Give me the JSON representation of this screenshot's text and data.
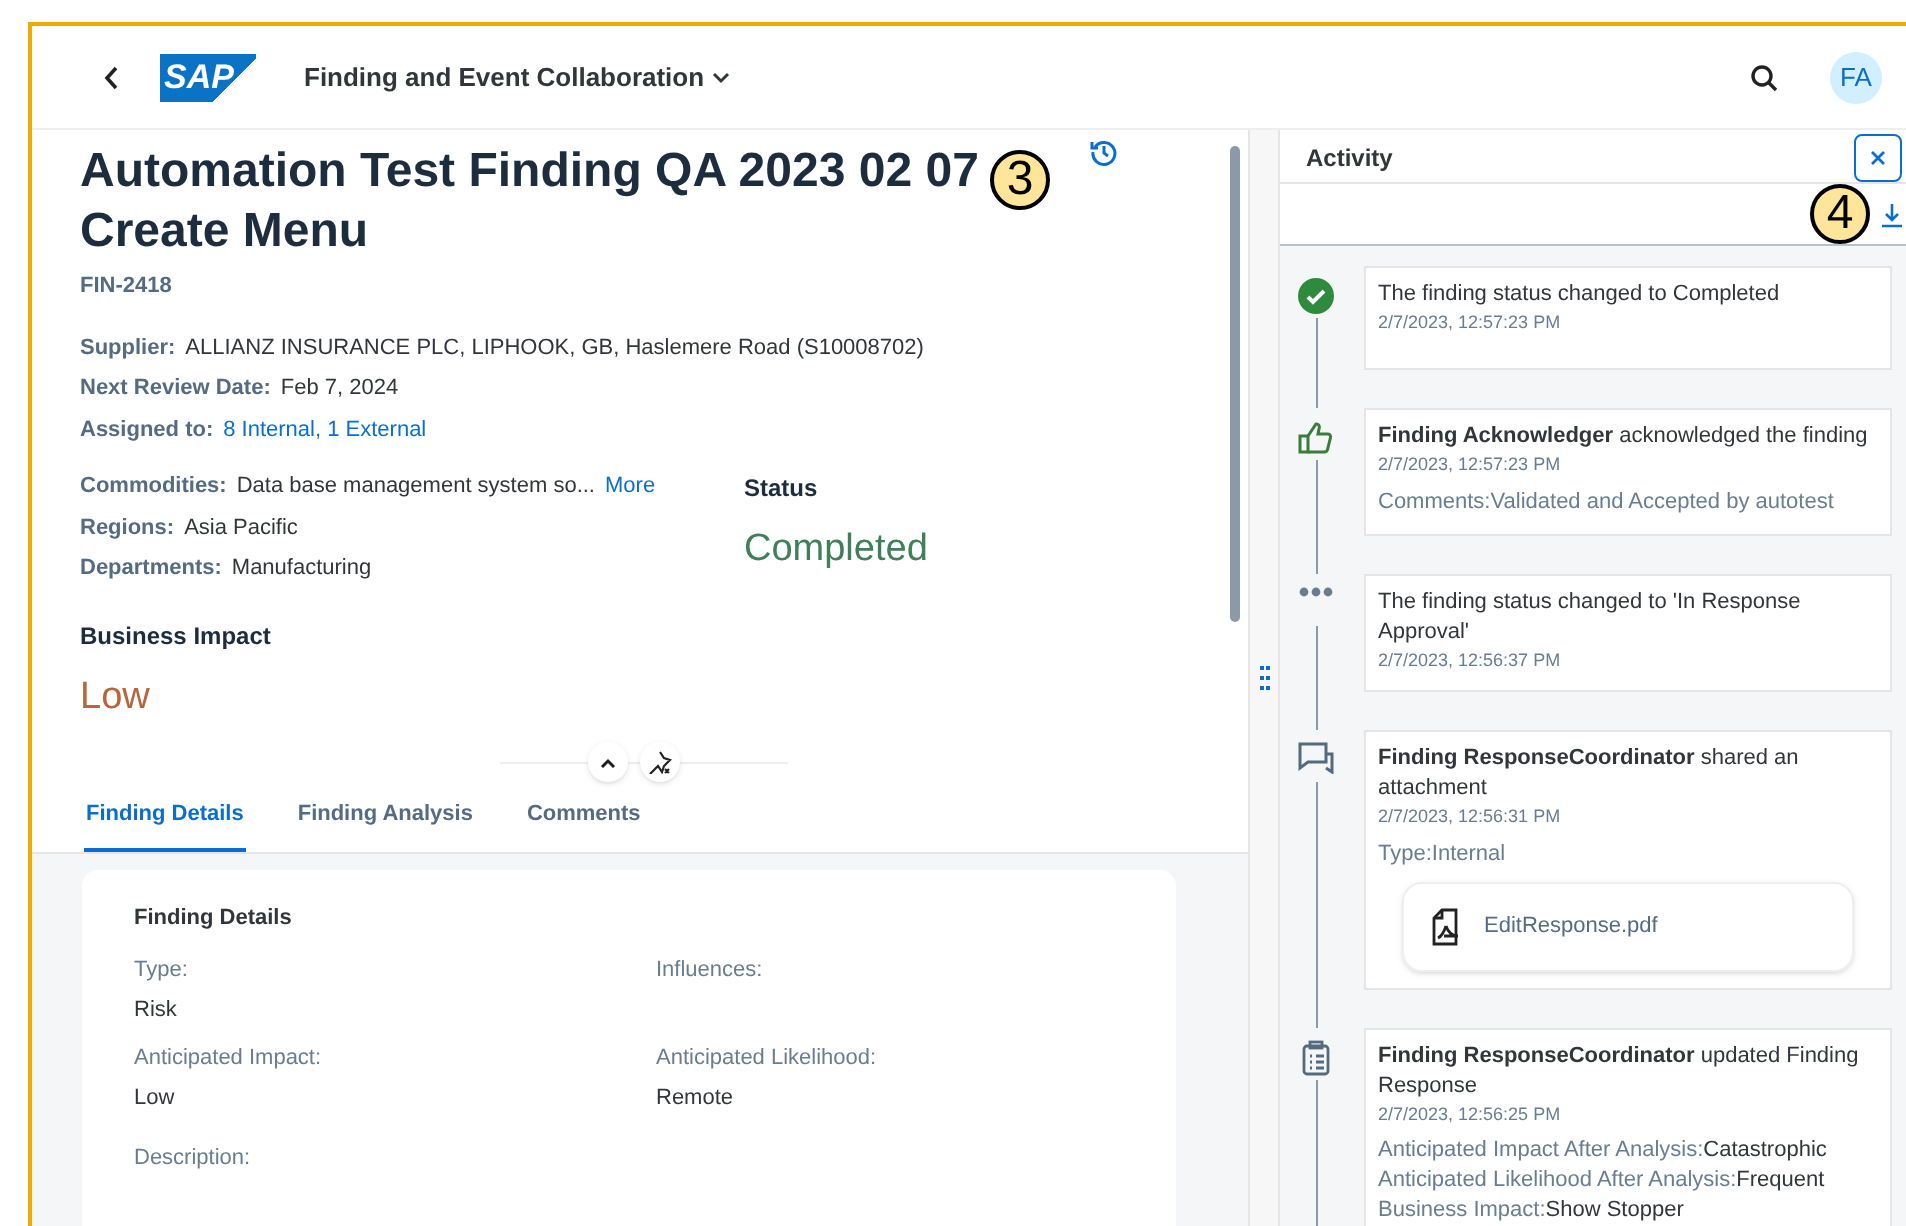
{
  "shell": {
    "logo": "SAP",
    "app_title": "Finding and Event Collaboration",
    "avatar": "FA"
  },
  "header": {
    "title": "Automation Test Finding QA 2023 02 07 Create Menu",
    "id": "FIN-2418",
    "facts": [
      {
        "label": "Supplier:",
        "value": "ALLIANZ INSURANCE PLC, LIPHOOK, GB, Haslemere Road (S10008702)",
        "kind": "text"
      },
      {
        "label": "Next Review Date:",
        "value": "Feb 7, 2024",
        "kind": "text"
      },
      {
        "label": "Assigned to:",
        "value": "8 Internal, 1 External",
        "kind": "link"
      }
    ],
    "facts2": [
      {
        "label": "Commodities:",
        "value": "Data base management system so...",
        "link": "More"
      },
      {
        "label": "Regions:",
        "value": "Asia Pacific"
      },
      {
        "label": "Departments:",
        "value": "Manufacturing"
      }
    ],
    "status": {
      "label": "Status",
      "value": "Completed"
    },
    "business_impact": {
      "label": "Business Impact",
      "value": "Low"
    }
  },
  "tabs": [
    {
      "label": "Finding Details",
      "selected": true
    },
    {
      "label": "Finding Analysis",
      "selected": false
    },
    {
      "label": "Comments",
      "selected": false
    }
  ],
  "details": {
    "title": "Finding Details",
    "fields": [
      {
        "label": "Type:",
        "value": "Risk"
      },
      {
        "label": "Influences:"
      },
      {
        "label": "Anticipated Impact:",
        "value": "Low"
      },
      {
        "label": "Anticipated Likelihood:",
        "value": "Remote"
      },
      {
        "label": "Description:"
      }
    ]
  },
  "activity": {
    "title": "Activity",
    "items": [
      {
        "kind": "status",
        "text": "The finding status changed to Completed",
        "time": "2/7/2023, 12:57:23 PM"
      },
      {
        "kind": "acknowledge",
        "text": "**Finding Acknowledger** acknowledged the finding",
        "time": "2/7/2023, 12:57:23 PM",
        "details": [
          {
            "label": "Comments:",
            "value": "Validated and Accepted by autotest"
          }
        ]
      },
      {
        "kind": "progress",
        "text": "The finding status changed to 'In Response Approval'",
        "time": "2/7/2023, 12:56:37 PM"
      },
      {
        "kind": "comment",
        "text": "**Finding ResponseCoordinator** shared an attachment",
        "time": "2/7/2023, 12:56:31 PM",
        "details": [
          {
            "label": "Type:",
            "value": "Internal"
          }
        ],
        "attachment": "EditResponse.pdf"
      },
      {
        "kind": "form",
        "text": "**Finding ResponseCoordinator** updated Finding Response",
        "time": "2/7/2023, 12:56:25 PM",
        "details": [
          {
            "label": "Anticipated Impact After Analysis:",
            "value": "Catastrophic"
          },
          {
            "label": "Anticipated Likelihood After Analysis:",
            "value": "Frequent"
          },
          {
            "label": "Business Impact:",
            "value": "Show Stopper"
          }
        ]
      }
    ]
  },
  "callouts": [
    "3",
    "4"
  ]
}
